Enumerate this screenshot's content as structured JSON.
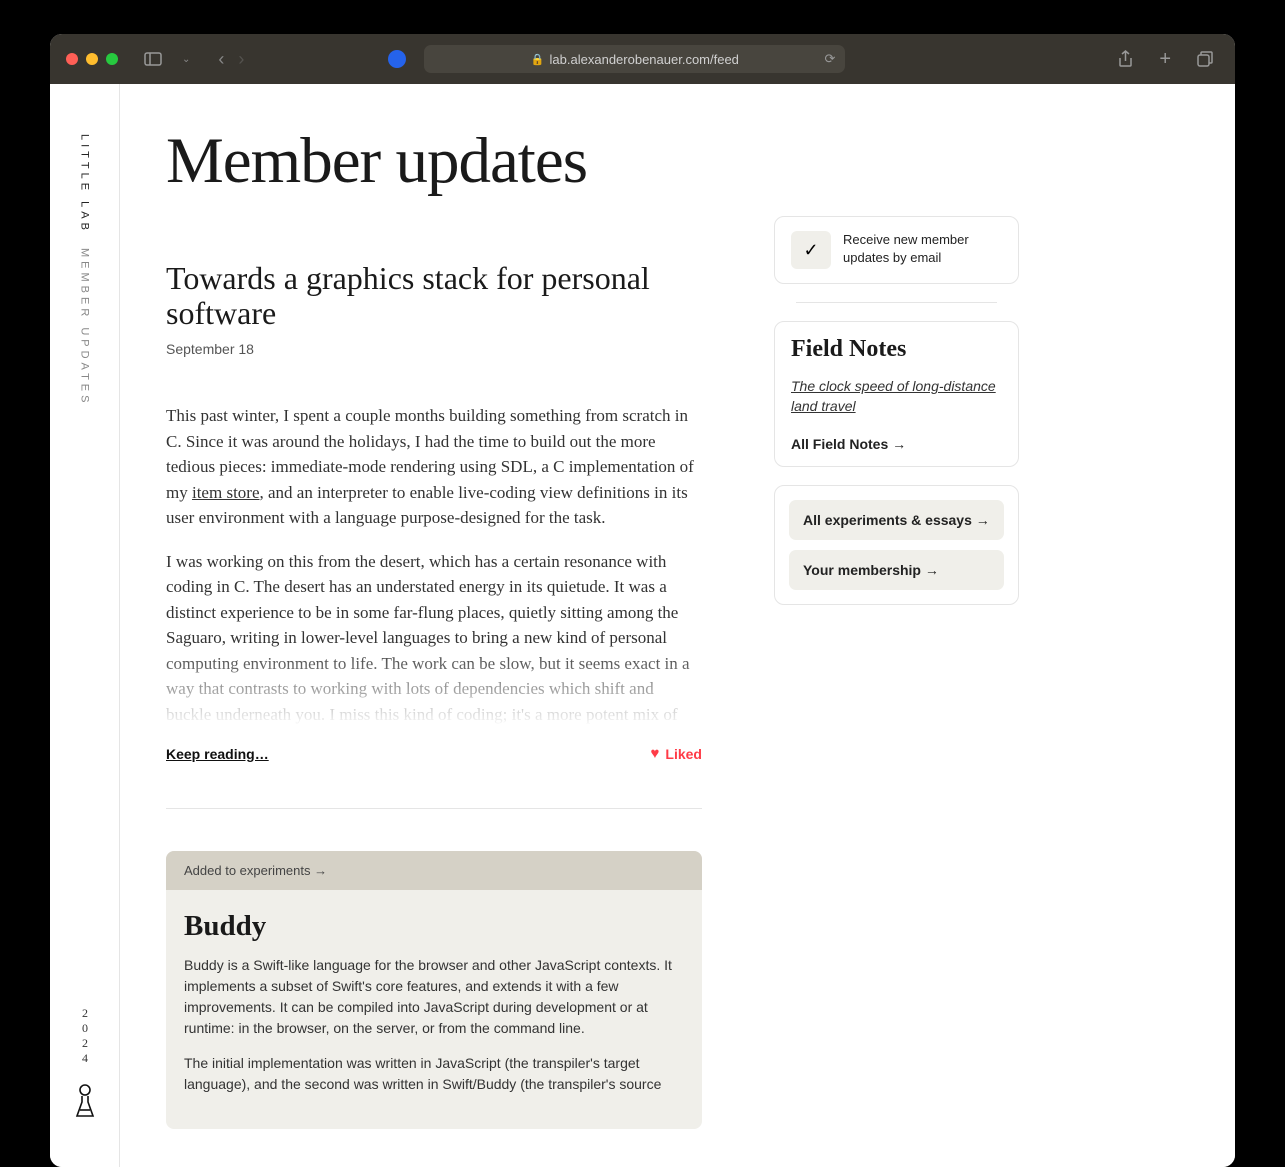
{
  "browser": {
    "url": "lab.alexanderobenauer.com/feed"
  },
  "rail": {
    "brand": "LITTLE LAB",
    "section": "MEMBER UPDATES",
    "year": "2024"
  },
  "page": {
    "title": "Member updates"
  },
  "post": {
    "title": "Towards a graphics stack for personal software",
    "date": "September 18",
    "para1a": "This past winter, I spent a couple months building something from scratch in C. Since it was around the holidays, I had the time to build out the more tedious pieces: immediate-mode rendering using SDL, a C implementation of my ",
    "item_store": "item store",
    "para1b": ", and an interpreter to enable live-coding view definitions in its user environment with a language purpose-designed for the task.",
    "para2": "I was working on this from the desert, which has a certain resonance with coding in C. The desert has an understated energy in its quietude. It was a distinct experience to be in some far-flung places, quietly sitting among the Saguaro, writing in lower-level languages to bring a new kind of personal computing environment to life. The work can be slow, but it seems exact in a way that contrasts to working with lots of dependencies which shift and buckle underneath you. I miss this kind of coding; it's a more potent mix of",
    "keep_reading": "Keep reading…",
    "liked_label": "Liked"
  },
  "experiment": {
    "badge": "Added to experiments →",
    "title": "Buddy",
    "p1": "Buddy is a Swift-like language for the browser and other JavaScript contexts. It implements a subset of Swift's core features, and extends it with a few improvements. It can be compiled into JavaScript during development or at runtime: in the browser, on the server, or from the command line.",
    "p2": "The initial implementation was written in JavaScript (the transpiler's target language), and the second was written in Swift/Buddy (the transpiler's source"
  },
  "aside": {
    "subscribe": "Receive new member updates by email",
    "field_notes_title": "Field Notes",
    "field_notes_link": "The clock speed of long-distance land travel",
    "all_field_notes": "All Field Notes →",
    "all_experiments": "All experiments & essays →",
    "membership": "Your membership →"
  }
}
